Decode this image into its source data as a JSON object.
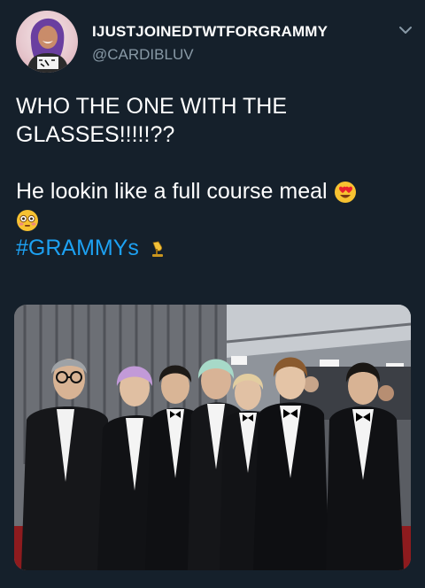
{
  "user": {
    "display_name": "IJUSTJOINEDTWTFORGRAMMY",
    "handle": "@CARDIBLUV",
    "avatar_icon": "profile-photo"
  },
  "tweet": {
    "line1": "WHO THE ONE WITH THE",
    "line2": "GLASSES!!!!!??",
    "line3": "He lookin like a full course meal",
    "hashtag": "#GRAMMYs",
    "emoji_1": "heart-eyes-emoji",
    "emoji_2": "flushed-face-emoji",
    "emoji_3": "gramophone-emoji"
  },
  "menu": {
    "icon": "chevron-down-icon"
  },
  "media": {
    "alt": "group photo of seven men in black tuxedos on red carpet"
  },
  "colors": {
    "background": "#15202b",
    "text": "#ffffff",
    "secondary": "#8899a6",
    "link": "#1da1f2"
  }
}
